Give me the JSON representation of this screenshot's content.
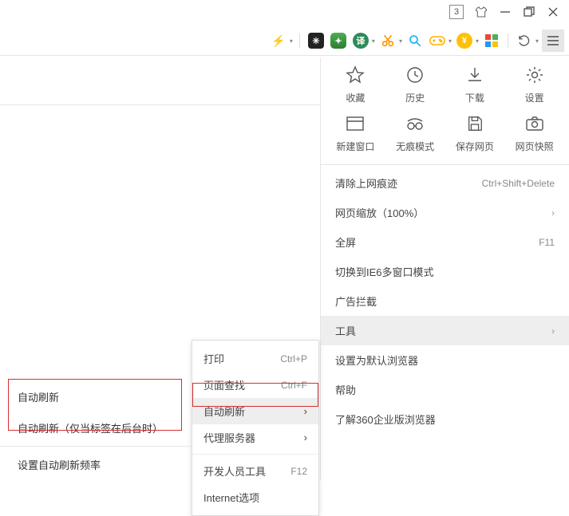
{
  "titlebar": {
    "badge": "3"
  },
  "toolbar": {
    "lightning": "⚡",
    "translate": "译",
    "currency": "¥"
  },
  "grid": [
    {
      "label": "收藏"
    },
    {
      "label": "历史"
    },
    {
      "label": "下载"
    },
    {
      "label": "设置"
    },
    {
      "label": "新建窗口"
    },
    {
      "label": "无痕模式"
    },
    {
      "label": "保存网页"
    },
    {
      "label": "网页快照"
    }
  ],
  "menu": {
    "clear_trace": "清除上网痕迹",
    "clear_trace_short": "Ctrl+Shift+Delete",
    "zoom": "网页缩放（100%）",
    "fullscreen": "全屏",
    "fullscreen_short": "F11",
    "ie6": "切换到IE6多窗口模式",
    "adblock": "广告拦截",
    "tools": "工具",
    "set_default": "设置为默认浏览器",
    "help": "帮助",
    "about": "了解360企业版浏览器"
  },
  "tools_sub": {
    "print": "打印",
    "print_short": "Ctrl+P",
    "find": "页面查找",
    "find_short": "Ctrl+F",
    "auto_refresh": "自动刷新",
    "proxy": "代理服务器",
    "devtools": "开发人员工具",
    "devtools_short": "F12",
    "ie_options": "Internet选项"
  },
  "refresh_sub": {
    "auto_refresh": "自动刷新",
    "auto_refresh_bg": "自动刷新（仅当标签在后台时）",
    "set_freq": "设置自动刷新频率"
  }
}
